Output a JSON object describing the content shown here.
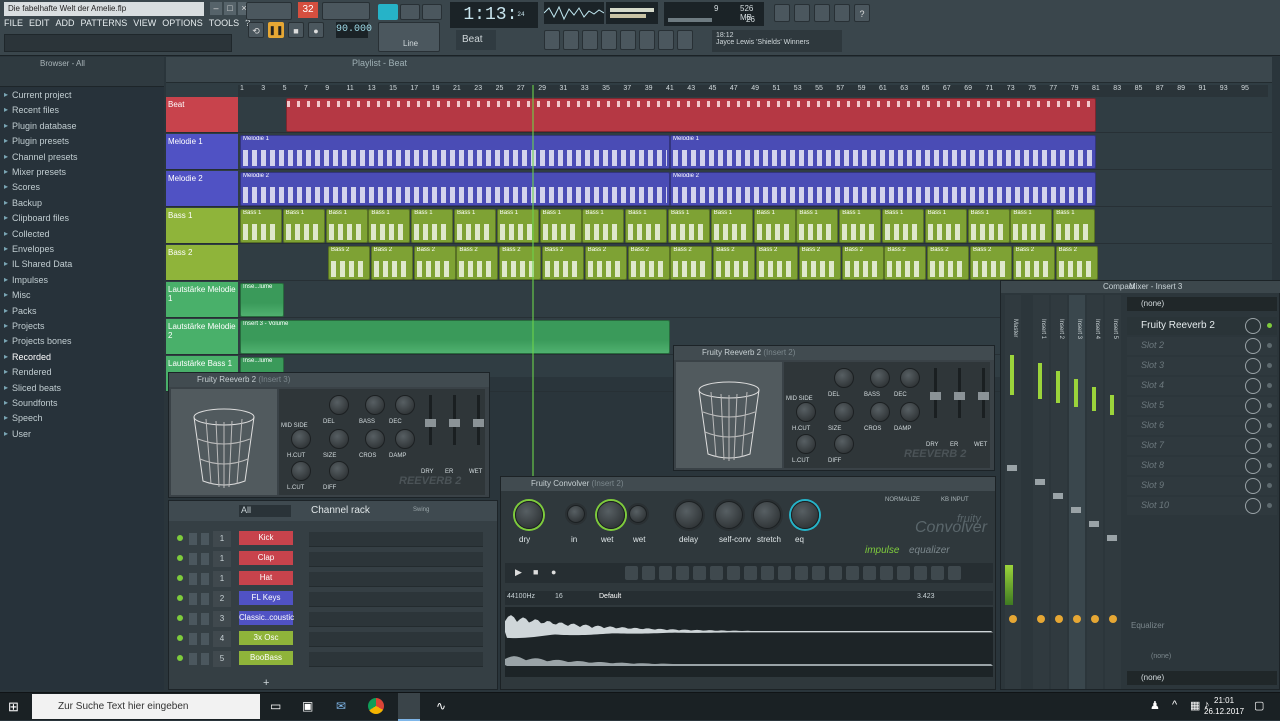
{
  "app": {
    "title": "Die fabelhafte Welt der Amelie.flp",
    "menu": [
      "FILE",
      "EDIT",
      "ADD",
      "PATTERNS",
      "VIEW",
      "OPTIONS",
      "TOOLS",
      "?"
    ]
  },
  "transport": {
    "clock": "1:13",
    "clock_sub": "24",
    "tempo": "90.000",
    "pattern": "Beat",
    "record_mode_badge": "32",
    "mode": "Line",
    "cpu": "9",
    "mem": "526 MB",
    "voices": "26",
    "hint_time": "18:12",
    "hint_text": "Jayce Lewis 'Shields' Winners"
  },
  "browser": {
    "header": "Browser - All",
    "items": [
      "Current project",
      "Recent files",
      "Plugin database",
      "Plugin presets",
      "Channel presets",
      "Mixer presets",
      "Scores",
      "Backup",
      "Clipboard files",
      "Collected",
      "Envelopes",
      "IL Shared Data",
      "Impulses",
      "Misc",
      "Packs",
      "Projects",
      "Projects bones",
      "Recorded",
      "Rendered",
      "Sliced beats",
      "Soundfonts",
      "Speech",
      "User"
    ]
  },
  "playlist": {
    "title": "Playlist - Beat",
    "ruler": [
      "1",
      "3",
      "5",
      "7",
      "9",
      "11",
      "13",
      "15",
      "17",
      "19",
      "21",
      "23",
      "25",
      "27",
      "29",
      "31",
      "33",
      "35",
      "37",
      "39",
      "41",
      "43",
      "45",
      "47",
      "49",
      "51",
      "53",
      "55",
      "57",
      "59",
      "61",
      "63",
      "65",
      "67",
      "69",
      "71",
      "73",
      "75",
      "77",
      "79",
      "81",
      "83",
      "85",
      "87",
      "89",
      "91",
      "93",
      "95"
    ],
    "tracks": [
      {
        "name": "Beat",
        "color": "#c8434c",
        "clip_color": "#b53844"
      },
      {
        "name": "Melodie 1",
        "color": "#5052c4",
        "clip_color": "#4a4cb5",
        "clip_label": "Melodie 1"
      },
      {
        "name": "Melodie 2",
        "color": "#5052c4",
        "clip_color": "#4a4cb5",
        "clip_label": "Melodie 2"
      },
      {
        "name": "Bass 1",
        "color": "#8fb43a",
        "clip_color": "#7ea234",
        "clip_label": "Bass 1"
      },
      {
        "name": "Bass 2",
        "color": "#8fb43a",
        "clip_color": "#7ea234",
        "clip_label": "Bass 2"
      },
      {
        "name": "Lautstärke Melodie 1",
        "color": "#49b06a",
        "clip_color": "#3a9a5a",
        "clip_label": "Inse...lume"
      },
      {
        "name": "Lautstärke Melodie 2",
        "color": "#49b06a",
        "clip_color": "#3a9a5a",
        "clip_label": "Insert 3 - Volume"
      },
      {
        "name": "Lautstärke Bass 1",
        "color": "#49b06a",
        "clip_color": "#3a9a5a",
        "clip_label": "Inse...lume"
      }
    ]
  },
  "reverb1": {
    "title": "Fruity Reeverb 2",
    "insert": "(Insert 3)",
    "labels": [
      "MID SIDE",
      "DEL",
      "BASS",
      "DEC",
      "H.CUT",
      "SIZE",
      "CROS",
      "DAMP",
      "DRY",
      "ER",
      "WET",
      "L.CUT",
      "DIFF"
    ],
    "logo": "REEVERB 2"
  },
  "reverb2": {
    "title": "Fruity Reeverb 2",
    "insert": "(Insert 2)",
    "labels": [
      "MID SIDE",
      "DEL",
      "BASS",
      "DEC",
      "H.CUT",
      "SIZE",
      "CROS",
      "DAMP",
      "DRY",
      "ER",
      "WET",
      "L.CUT",
      "DIFF"
    ],
    "logo": "REEVERB 2"
  },
  "channelrack": {
    "filter": "All",
    "title": "Channel rack",
    "swing": "Swing",
    "channels": [
      {
        "num": "1",
        "name": "Kick",
        "color": "#c8434c"
      },
      {
        "num": "1",
        "name": "Clap",
        "color": "#c8434c"
      },
      {
        "num": "1",
        "name": "Hat",
        "color": "#c8434c"
      },
      {
        "num": "2",
        "name": "FL Keys",
        "color": "#5052c4"
      },
      {
        "num": "3",
        "name": "Classic..coustic",
        "color": "#5052c4"
      },
      {
        "num": "4",
        "name": "3x Osc",
        "color": "#8fb43a"
      },
      {
        "num": "5",
        "name": "BooBass",
        "color": "#8fb43a"
      }
    ],
    "add": "+"
  },
  "convolver": {
    "title": "Fruity Convolver",
    "insert": "(Insert 2)",
    "knobs": [
      "dry",
      "in",
      "wet",
      "wet",
      "delay",
      "self-conv",
      "stretch",
      "eq"
    ],
    "tabs": [
      "impulse",
      "equalizer"
    ],
    "normalize": "NORMALIZE",
    "kb": "KB INPUT",
    "rate": "44100Hz",
    "bits": "16",
    "preset": "Default",
    "len": "3.423",
    "brand": "Convolver",
    "brand2": "fruity"
  },
  "mixer": {
    "view": "Compact",
    "title": "Mixer - Insert 3",
    "strips": [
      "Master",
      "Insert 1",
      "Insert 2",
      "Insert 3",
      "Insert 4",
      "Insert 5"
    ],
    "selected": "(none)",
    "slots": [
      "Fruity Reeverb 2",
      "Slot 2",
      "Slot 3",
      "Slot 4",
      "Slot 5",
      "Slot 6",
      "Slot 7",
      "Slot 8",
      "Slot 9",
      "Slot 10"
    ],
    "eq": "Equalizer",
    "out": "(none)",
    "out2": "(none)"
  },
  "taskbar": {
    "search": "Zur Suche Text hier eingeben",
    "time": "21:01",
    "date": "26.12.2017"
  }
}
